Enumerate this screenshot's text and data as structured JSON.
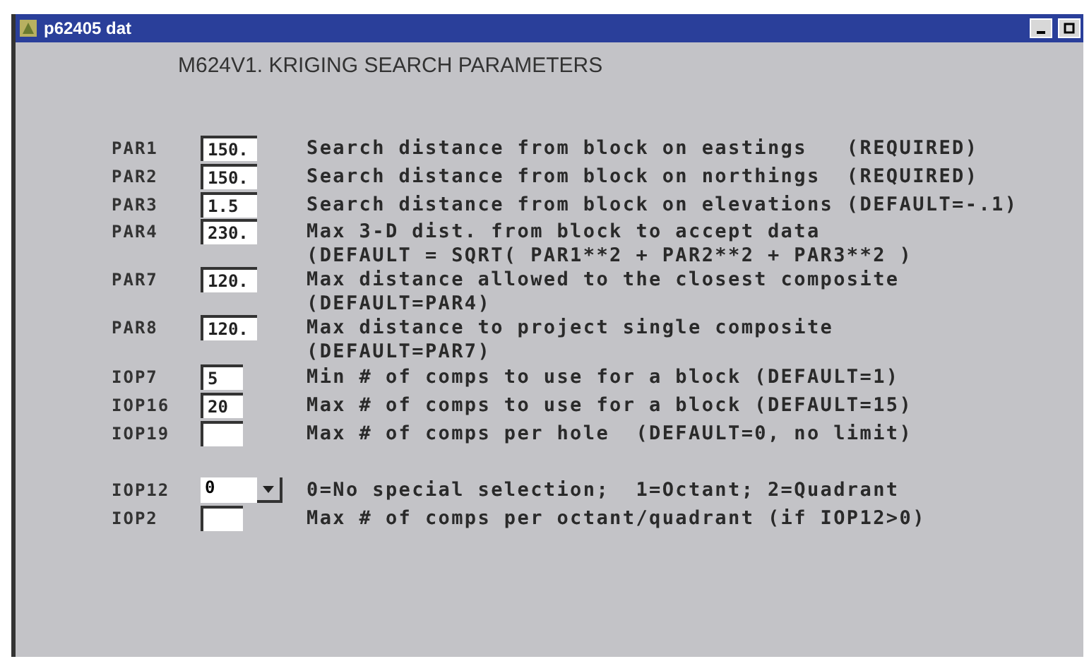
{
  "window": {
    "title": "p62405 dat",
    "heading": "M624V1.  KRIGING SEARCH PARAMETERS"
  },
  "groups": [
    {
      "rows": [
        {
          "label": "PAR1",
          "field": {
            "kind": "long",
            "value": "150."
          },
          "description": "Search distance from block on eastings   (REQUIRED)"
        },
        {
          "label": "PAR2",
          "field": {
            "kind": "long",
            "value": "150."
          },
          "description": "Search distance from block on northings  (REQUIRED)"
        },
        {
          "label": "PAR3",
          "field": {
            "kind": "long",
            "value": "1.5"
          },
          "description": "Search distance from block on elevations (DEFAULT=-.1)"
        },
        {
          "label": "PAR4",
          "field": {
            "kind": "long",
            "value": "230."
          },
          "description": "Max 3-D dist. from block to accept data",
          "note": "(DEFAULT = SQRT( PAR1**2 + PAR2**2 + PAR3**2 )"
        },
        {
          "label": "PAR7",
          "field": {
            "kind": "long",
            "value": "120."
          },
          "description": "Max distance allowed to the closest composite",
          "note": "(DEFAULT=PAR4)"
        },
        {
          "label": "PAR8",
          "field": {
            "kind": "long",
            "value": "120."
          },
          "description": "Max distance to project single composite",
          "note": "(DEFAULT=PAR7)"
        },
        {
          "label": "IOP7",
          "field": {
            "kind": "short",
            "value": "5"
          },
          "description": "Min # of comps to use for a block (DEFAULT=1)"
        },
        {
          "label": "IOP16",
          "field": {
            "kind": "short",
            "value": "20"
          },
          "description": "Max # of comps to use for a block (DEFAULT=15)"
        },
        {
          "label": "IOP19",
          "field": {
            "kind": "short"
          },
          "description": "Max # of comps per hole  (DEFAULT=0, no limit)"
        }
      ]
    },
    {
      "rows": [
        {
          "label": "IOP12",
          "field": {
            "kind": "combo",
            "value": "0"
          },
          "description": "0=No special selection;  1=Octant; 2=Quadrant"
        },
        {
          "label": "IOP2",
          "field": {
            "kind": "short"
          },
          "description": "Max # of comps per octant/quadrant (if IOP12>0)"
        }
      ]
    }
  ]
}
